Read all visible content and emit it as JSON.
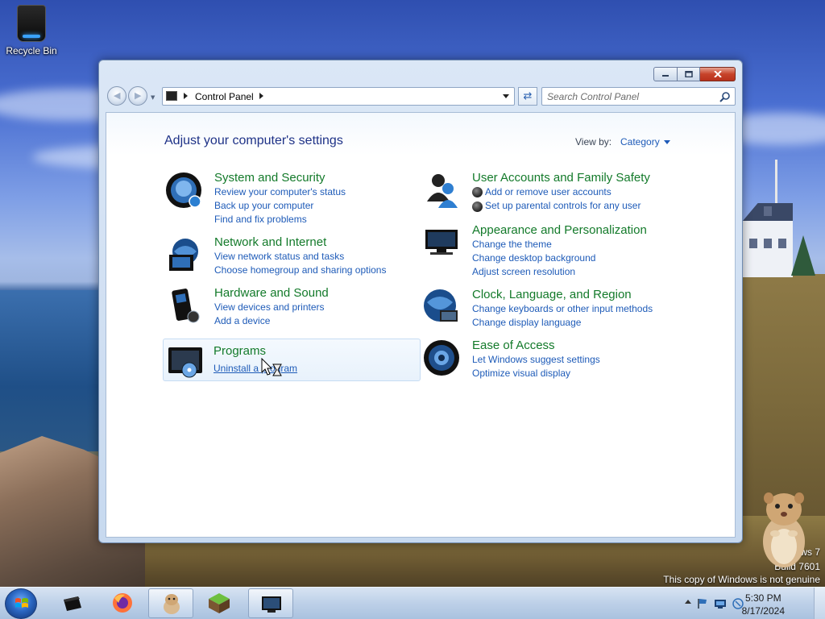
{
  "desktop": {
    "recycle_bin_label": "Recycle Bin",
    "watermark": {
      "line1": "ws 7",
      "line2": "Build 7601",
      "line3": "This copy of Windows is not genuine"
    }
  },
  "window": {
    "address": {
      "crumb": "Control Panel"
    },
    "search": {
      "placeholder": "Search Control Panel"
    },
    "page_title": "Adjust your computer's settings",
    "view_by": {
      "label": "View by:",
      "value": "Category"
    },
    "categories": [
      {
        "title": "System and Security",
        "icon": "system-security-icon",
        "links": [
          "Review your computer's status",
          "Back up your computer",
          "Find and fix problems"
        ]
      },
      {
        "title": "Network and Internet",
        "icon": "network-internet-icon",
        "links": [
          "View network status and tasks",
          "Choose homegroup and sharing options"
        ]
      },
      {
        "title": "Hardware and Sound",
        "icon": "hardware-sound-icon",
        "links": [
          "View devices and printers",
          "Add a device"
        ]
      },
      {
        "title": "Programs",
        "icon": "programs-icon",
        "links": [
          "Uninstall a program"
        ]
      },
      {
        "title": "User Accounts and Family Safety",
        "icon": "user-accounts-icon",
        "links": [
          "Add or remove user accounts",
          "Set up parental controls for any user"
        ]
      },
      {
        "title": "Appearance and Personalization",
        "icon": "appearance-icon",
        "links": [
          "Change the theme",
          "Change desktop background",
          "Adjust screen resolution"
        ]
      },
      {
        "title": "Clock, Language, and Region",
        "icon": "clock-language-icon",
        "links": [
          "Change keyboards or other input methods",
          "Change display language"
        ]
      },
      {
        "title": "Ease of Access",
        "icon": "ease-of-access-icon",
        "links": [
          "Let Windows suggest settings",
          "Optimize visual display"
        ]
      }
    ]
  },
  "taskbar": {
    "clock": {
      "time": "5:30 PM",
      "date": "8/17/2024"
    },
    "pinned": [
      "computer-icon",
      "firefox-icon",
      "hamster-app-icon",
      "minecraft-icon",
      "control-panel-icon"
    ]
  },
  "colors": {
    "category_title": "#137a2a",
    "link": "#1e5bb8",
    "heading": "#1e3287"
  }
}
